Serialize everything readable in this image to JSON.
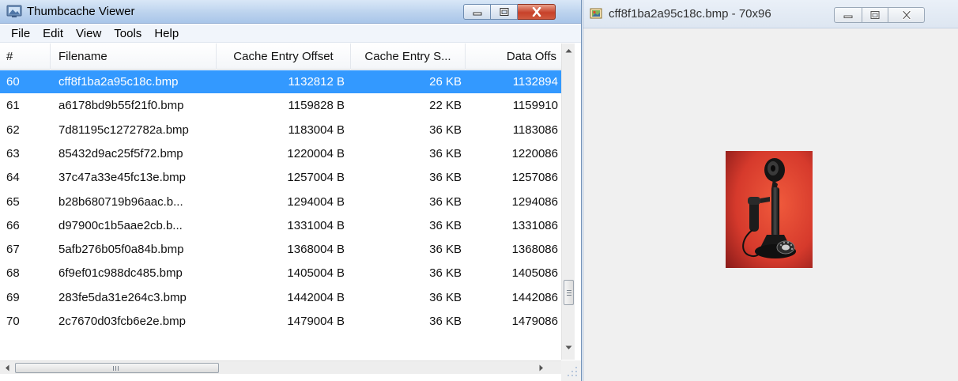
{
  "main_window": {
    "title": "Thumbcache Viewer",
    "menu": [
      "File",
      "Edit",
      "View",
      "Tools",
      "Help"
    ],
    "columns": [
      "#",
      "Filename",
      "Cache Entry Offset",
      "Cache Entry S...",
      "Data Offs"
    ],
    "rows": [
      {
        "num": "60",
        "filename": "cff8f1ba2a95c18c.bmp",
        "cache_entry_offset": "1132812 B",
        "cache_entry_size": "26 KB",
        "data_offset": "1132894",
        "selected": true
      },
      {
        "num": "61",
        "filename": "a6178bd9b55f21f0.bmp",
        "cache_entry_offset": "1159828 B",
        "cache_entry_size": "22 KB",
        "data_offset": "1159910",
        "selected": false
      },
      {
        "num": "62",
        "filename": "7d81195c1272782a.bmp",
        "cache_entry_offset": "1183004 B",
        "cache_entry_size": "36 KB",
        "data_offset": "1183086",
        "selected": false
      },
      {
        "num": "63",
        "filename": "85432d9ac25f5f72.bmp",
        "cache_entry_offset": "1220004 B",
        "cache_entry_size": "36 KB",
        "data_offset": "1220086",
        "selected": false
      },
      {
        "num": "64",
        "filename": "37c47a33e45fc13e.bmp",
        "cache_entry_offset": "1257004 B",
        "cache_entry_size": "36 KB",
        "data_offset": "1257086",
        "selected": false
      },
      {
        "num": "65",
        "filename": "b28b680719b96aac.b...",
        "cache_entry_offset": "1294004 B",
        "cache_entry_size": "36 KB",
        "data_offset": "1294086",
        "selected": false
      },
      {
        "num": "66",
        "filename": "d97900c1b5aae2cb.b...",
        "cache_entry_offset": "1331004 B",
        "cache_entry_size": "36 KB",
        "data_offset": "1331086",
        "selected": false
      },
      {
        "num": "67",
        "filename": "5afb276b05f0a84b.bmp",
        "cache_entry_offset": "1368004 B",
        "cache_entry_size": "36 KB",
        "data_offset": "1368086",
        "selected": false
      },
      {
        "num": "68",
        "filename": "6f9ef01c988dc485.bmp",
        "cache_entry_offset": "1405004 B",
        "cache_entry_size": "36 KB",
        "data_offset": "1405086",
        "selected": false
      },
      {
        "num": "69",
        "filename": "283fe5da31e264c3.bmp",
        "cache_entry_offset": "1442004 B",
        "cache_entry_size": "36 KB",
        "data_offset": "1442086",
        "selected": false
      },
      {
        "num": "70",
        "filename": "2c7670d03fcb6e2e.bmp",
        "cache_entry_offset": "1479004 B",
        "cache_entry_size": "36 KB",
        "data_offset": "1479086",
        "selected": false
      }
    ]
  },
  "preview_window": {
    "title": "cff8f1ba2a95c18c.bmp - 70x96"
  },
  "icons": {
    "app": "thumbcache-viewer-icon",
    "preview": "image-file-icon",
    "thumbnail": "candlestick-telephone-thumbnail"
  },
  "colors": {
    "selection": "#3399ff",
    "close_button": "#c7412a",
    "thumbnail_background": "#d63a2c"
  }
}
